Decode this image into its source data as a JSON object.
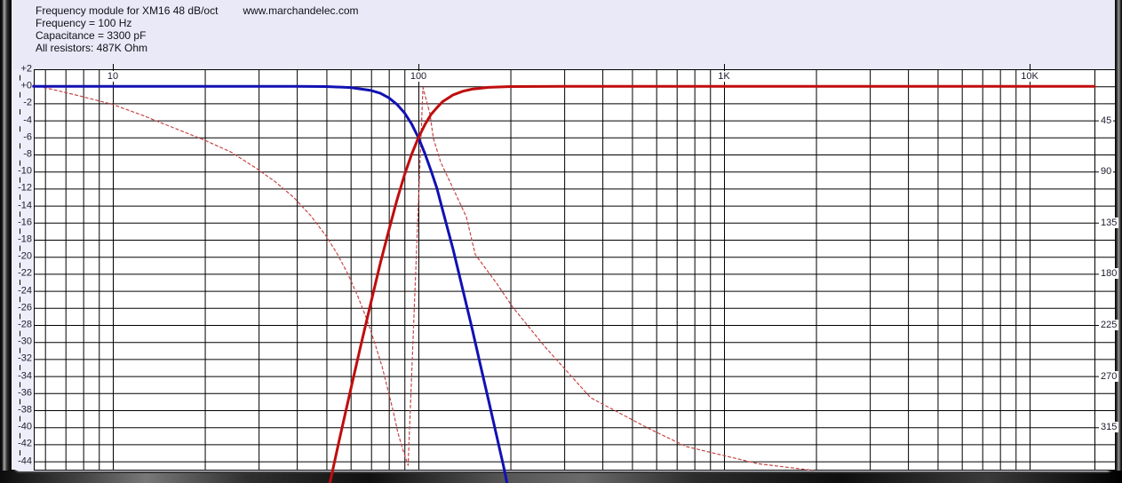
{
  "header": {
    "title": "Frequency module for XM16 48 dB/oct",
    "url": "www.marchandelec.com",
    "param_lines": [
      "Frequency = 100 Hz",
      "Capacitance = 3300 pF",
      "All resistors: 487K Ohm"
    ]
  },
  "colors": {
    "window_bg": "#e9e9f7",
    "plot_bg": "#ffffff",
    "grid": "#000000",
    "lowpass": "#1111b3",
    "highpass": "#c00d0d",
    "phase": "#c54545",
    "label_text": "#1c1c2e"
  },
  "chart_data": {
    "type": "line",
    "x_axis": {
      "scale": "log",
      "unit": "Hz",
      "min_hz": 5.5,
      "max_hz": 16300,
      "tick_labels": [
        {
          "label": "10",
          "f": 10
        },
        {
          "label": "100",
          "f": 100
        },
        {
          "label": "1K",
          "f": 1000
        },
        {
          "label": "10K",
          "f": 10000
        }
      ],
      "gridline_freqs": [
        6,
        7,
        8,
        9,
        10,
        20,
        30,
        40,
        50,
        60,
        70,
        80,
        90,
        100,
        200,
        300,
        400,
        500,
        600,
        700,
        800,
        900,
        1000,
        2000,
        3000,
        4000,
        5000,
        6000,
        7000,
        8000,
        9000,
        10000
      ]
    },
    "y_axis_db": {
      "unit": "dB",
      "max": 2,
      "min": -44,
      "step": 2,
      "labels": [
        "+2",
        "+0",
        "-2",
        "-4",
        "-6",
        "-8",
        "-10",
        "-12",
        "-14",
        "-16",
        "-18",
        "-20",
        "-22",
        "-24",
        "-26",
        "-28",
        "-30",
        "-32",
        "-34",
        "-36",
        "-38",
        "-40",
        "-42",
        "-44"
      ]
    },
    "y_axis_phase": {
      "unit": "deg",
      "labels": [
        45,
        90,
        135,
        180,
        225,
        270,
        315
      ],
      "degrees_per_division": 45,
      "wrap_at": 360
    },
    "crossover": {
      "frequency_hz": 100,
      "level_db": -6,
      "slope": "48 dB/oct"
    },
    "series": [
      {
        "name": "lowpass-magnitude",
        "color": "#1111b3",
        "style": "solid",
        "axis": "db",
        "points": [
          [
            5.5,
            0
          ],
          [
            20,
            0
          ],
          [
            40,
            -0.01
          ],
          [
            50,
            -0.03
          ],
          [
            60,
            -0.15
          ],
          [
            70,
            -0.49
          ],
          [
            75,
            -0.8
          ],
          [
            80,
            -1.35
          ],
          [
            85,
            -2.1
          ],
          [
            90,
            -3.11
          ],
          [
            95,
            -4.42
          ],
          [
            100,
            -6.02
          ],
          [
            105,
            -7.9
          ],
          [
            110,
            -9.9
          ],
          [
            115,
            -12.0
          ],
          [
            120,
            -14.5
          ],
          [
            130,
            -19.2
          ],
          [
            140,
            -24.0
          ],
          [
            150,
            -28.5
          ],
          [
            160,
            -32.9
          ],
          [
            170,
            -37.0
          ],
          [
            180,
            -40.9
          ],
          [
            190,
            -44.6
          ],
          [
            195,
            -46.6
          ]
        ]
      },
      {
        "name": "highpass-magnitude",
        "color": "#c00d0d",
        "style": "solid",
        "axis": "db",
        "points": [
          [
            51,
            -47
          ],
          [
            55,
            -41.6
          ],
          [
            60,
            -35.6
          ],
          [
            65,
            -30.2
          ],
          [
            70,
            -25.3
          ],
          [
            75,
            -20.8
          ],
          [
            80,
            -16.9
          ],
          [
            85,
            -13.4
          ],
          [
            90,
            -10.4
          ],
          [
            95,
            -8.0
          ],
          [
            100,
            -6.02
          ],
          [
            105,
            -4.5
          ],
          [
            110,
            -3.3
          ],
          [
            115,
            -2.5
          ],
          [
            120,
            -1.8
          ],
          [
            130,
            -1.0
          ],
          [
            140,
            -0.57
          ],
          [
            150,
            -0.33
          ],
          [
            170,
            -0.12
          ],
          [
            200,
            -0.03
          ],
          [
            300,
            -0.01
          ],
          [
            16300,
            0
          ]
        ]
      },
      {
        "name": "phase",
        "color": "#c54545",
        "style": "dashed",
        "axis": "phase",
        "points": [
          [
            5.5,
            14
          ],
          [
            6.4,
            18
          ],
          [
            7.8,
            23.5
          ],
          [
            10,
            31
          ],
          [
            12.5,
            40.5
          ],
          [
            16.3,
            53
          ],
          [
            20,
            62.5
          ],
          [
            24.4,
            73
          ],
          [
            29.6,
            87.5
          ],
          [
            34,
            99
          ],
          [
            39,
            112.5
          ],
          [
            44.5,
            129
          ],
          [
            50,
            147
          ],
          [
            54.4,
            163
          ],
          [
            59,
            181
          ],
          [
            63.4,
            200
          ],
          [
            67.8,
            220
          ],
          [
            72,
            241
          ],
          [
            76.2,
            262.5
          ],
          [
            79.6,
            283
          ],
          [
            82.8,
            301.5
          ],
          [
            85.6,
            319.5
          ],
          [
            89,
            335
          ],
          [
            92.5,
            348.5
          ],
          [
            103.5,
            376
          ],
          [
            109,
            399
          ],
          [
            112,
            421
          ],
          [
            118.4,
            442
          ],
          [
            132,
            469
          ],
          [
            143.5,
            490
          ],
          [
            153.5,
            523
          ],
          [
            181,
            549
          ],
          [
            203,
            569
          ],
          [
            259,
            604
          ],
          [
            366,
            649
          ],
          [
            566,
            676
          ],
          [
            753,
            692
          ],
          [
            1290,
            707
          ],
          [
            1950,
            713
          ]
        ]
      }
    ]
  }
}
